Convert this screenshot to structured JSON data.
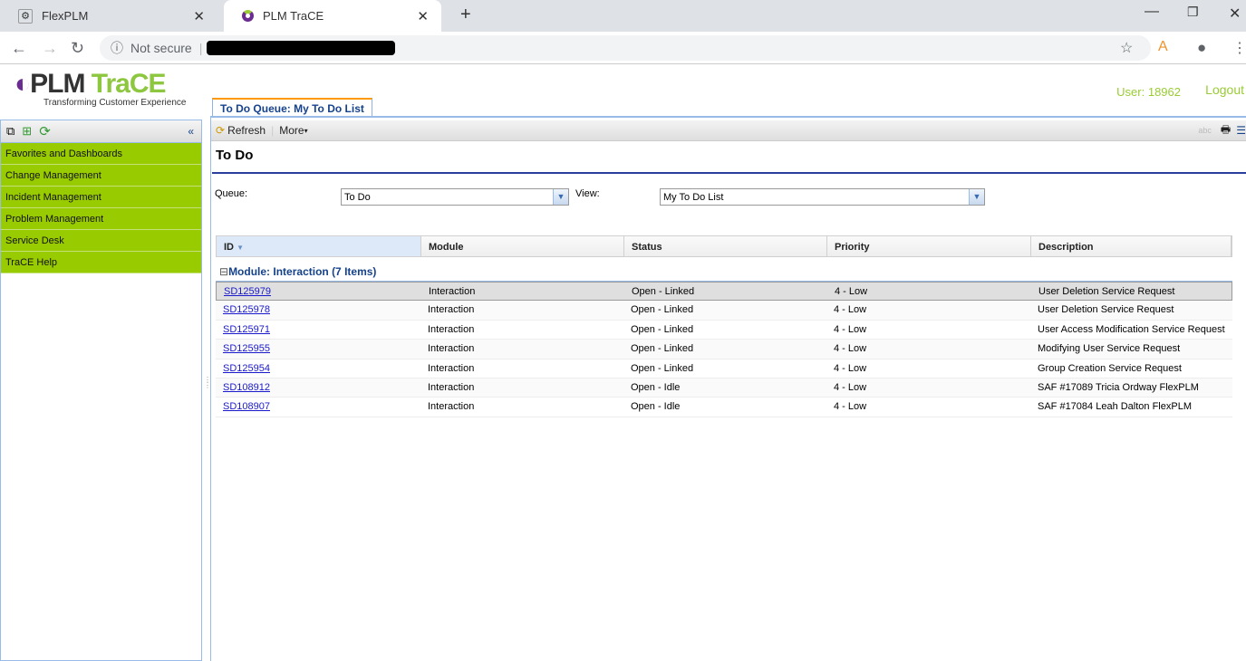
{
  "browser": {
    "tabs": [
      {
        "title": "FlexPLM"
      },
      {
        "title": "PLM TraCE"
      }
    ],
    "security": "Not secure"
  },
  "header": {
    "logo_main_a": "PLM",
    "logo_main_b": "TraCE",
    "logo_sub": "Transforming Customer Experience",
    "user": "User: 18962",
    "logout": "Logout"
  },
  "sidebar": {
    "items": [
      {
        "label": "Favorites and Dashboards"
      },
      {
        "label": "Change Management"
      },
      {
        "label": "Incident Management"
      },
      {
        "label": "Problem Management"
      },
      {
        "label": "Service Desk"
      },
      {
        "label": "TraCE Help"
      }
    ]
  },
  "main": {
    "tab": "To Do Queue: My To Do List",
    "toolbar": {
      "refresh": "Refresh",
      "more": "More"
    },
    "title": "To Do",
    "queue_label": "Queue:",
    "queue_value": "To Do",
    "view_label": "View:",
    "view_value": "My To Do List",
    "columns": [
      "ID",
      "Module",
      "Status",
      "Priority",
      "Description"
    ],
    "group": "Module: Interaction (7 Items)",
    "rows": [
      [
        "SD125979",
        "Interaction",
        "Open - Linked",
        "4 - Low",
        "User Deletion Service Request"
      ],
      [
        "SD125978",
        "Interaction",
        "Open - Linked",
        "4 - Low",
        "User Deletion Service Request"
      ],
      [
        "SD125971",
        "Interaction",
        "Open - Linked",
        "4 - Low",
        "User Access Modification Service Request"
      ],
      [
        "SD125955",
        "Interaction",
        "Open - Linked",
        "4 - Low",
        "Modifying User Service Request"
      ],
      [
        "SD125954",
        "Interaction",
        "Open - Linked",
        "4 - Low",
        "Group Creation Service Request"
      ],
      [
        "SD108912",
        "Interaction",
        "Open - Idle",
        "4 - Low",
        "SAF #17089 Tricia Ordway FlexPLM"
      ],
      [
        "SD108907",
        "Interaction",
        "Open - Idle",
        "4 - Low",
        "SAF #17084 Leah Dalton FlexPLM"
      ]
    ]
  }
}
